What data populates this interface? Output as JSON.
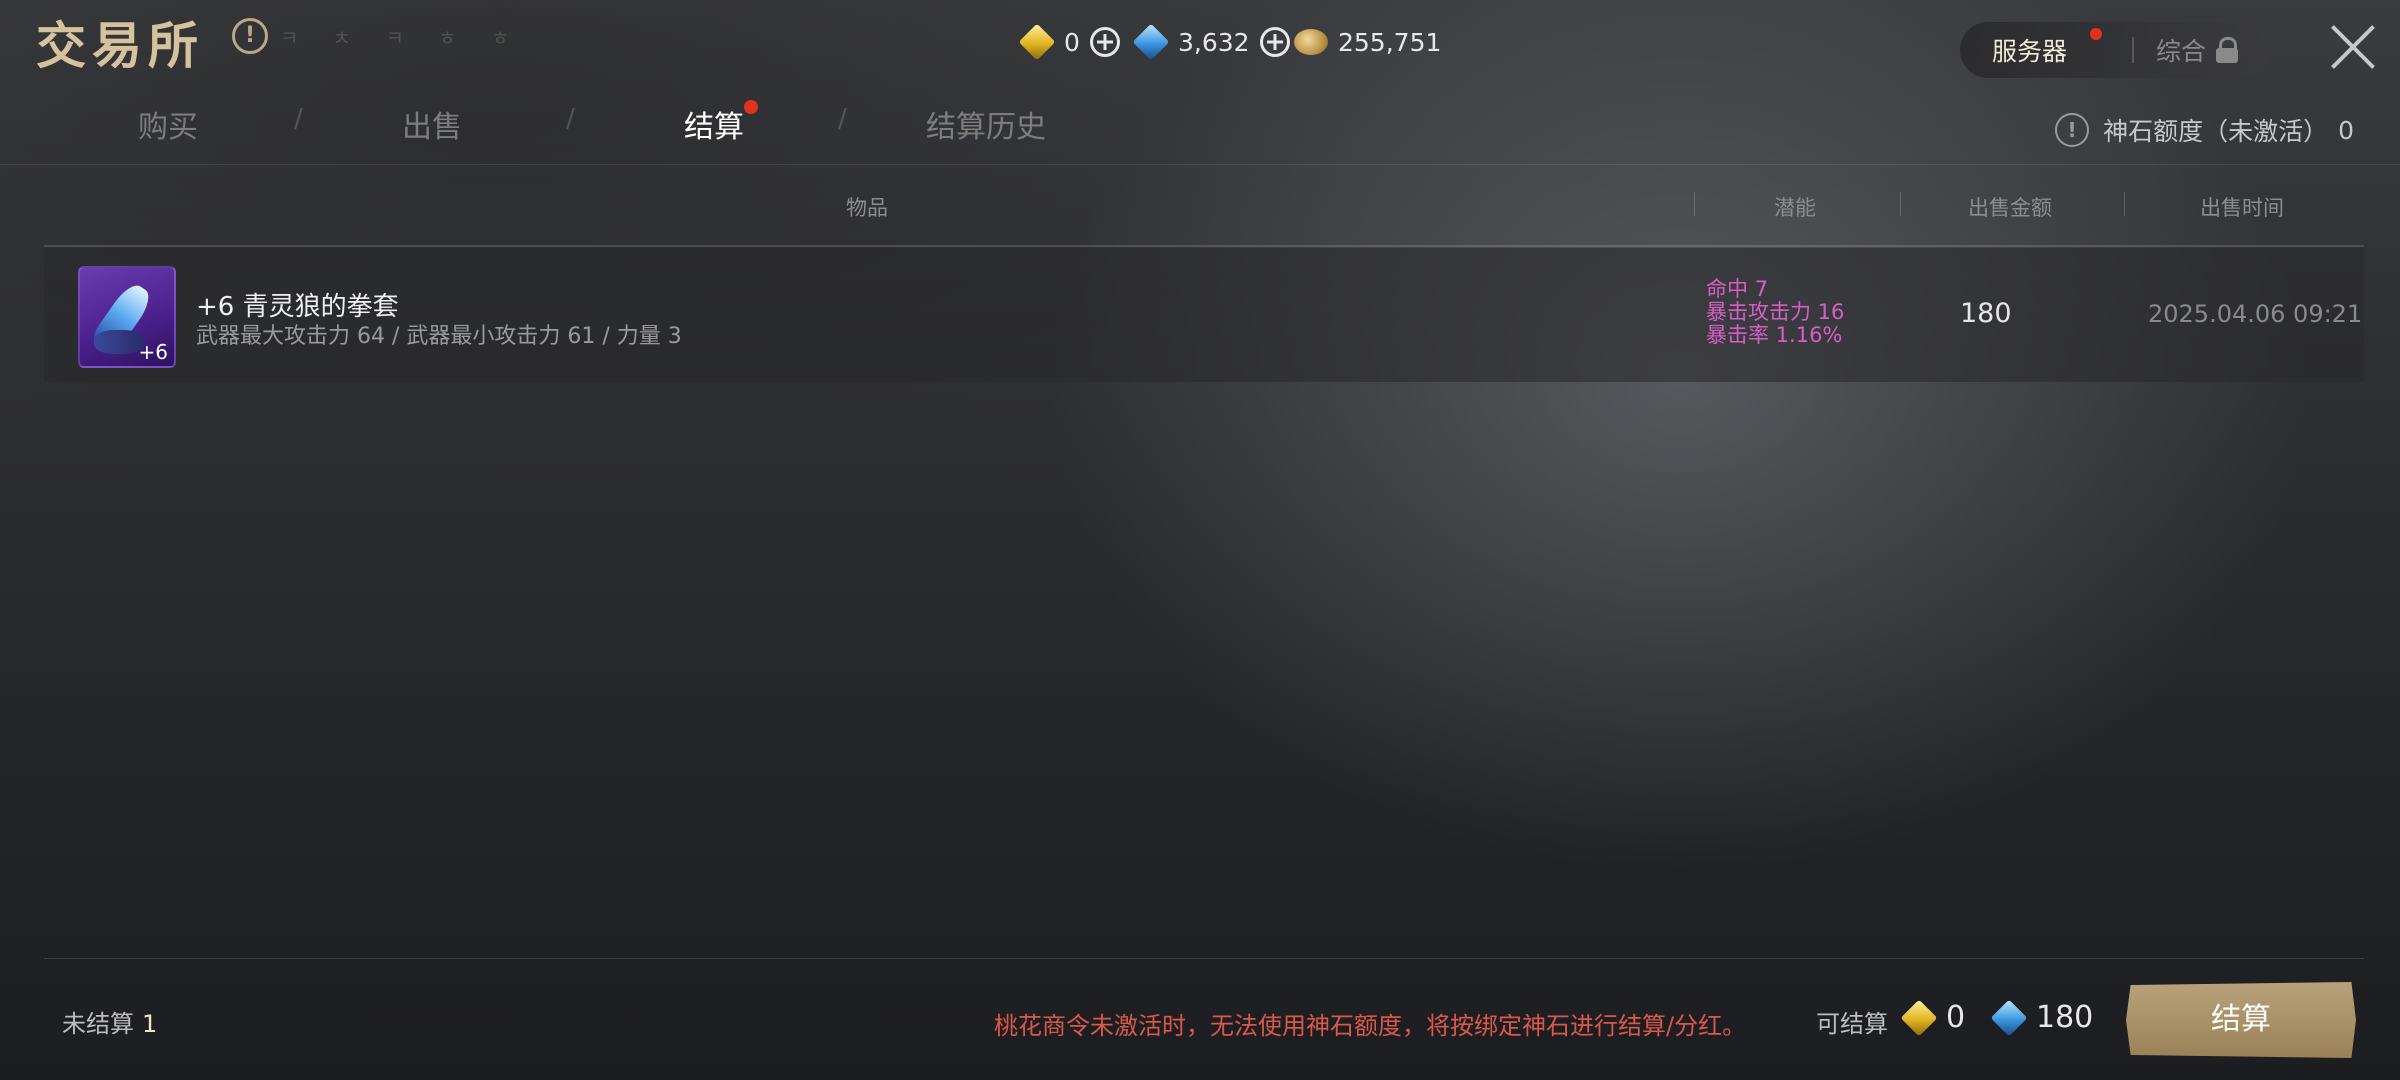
{
  "header": {
    "title": "交易所",
    "title_faint": "ㅋ ㅊ ㅋ ㅎ ㅎ",
    "currencies": {
      "gold_gem": "0",
      "blue_gem": "3,632",
      "coins": "255,751"
    },
    "server_toggle": {
      "server": "服务器",
      "all": "综合"
    }
  },
  "tabs": [
    {
      "label": "购买"
    },
    {
      "label": "出售"
    },
    {
      "label": "结算"
    },
    {
      "label": "结算历史"
    }
  ],
  "quota": {
    "label": "神石额度（未激活）",
    "value": "0"
  },
  "table": {
    "headers": [
      "物品",
      "潜能",
      "出售金额",
      "出售时间"
    ],
    "rows": [
      {
        "level": "+6",
        "name": "+6 青灵狼的拳套",
        "stats": "武器最大攻击力 64  / 武器最小攻击力 61  / 力量 3",
        "potentials": [
          "命中 7",
          "暴击攻击力 16",
          "暴击率 1.16%"
        ],
        "amount": "180",
        "time": "2025.04.06 09:21"
      }
    ]
  },
  "footer": {
    "unsettled_label": "未结算",
    "unsettled_count": "1",
    "warning": "桃花商令未激活时，无法使用神石额度，将按绑定神石进行结算/分红。",
    "settle_label": "可结算",
    "settle_gold": "0",
    "settle_blue": "180",
    "settle_button": "结算"
  },
  "colors": {
    "accent_gold": "#d6c29c",
    "notification_dot": "#e0321c",
    "potential_text": "#d65fc7",
    "warning_text": "#d9584a",
    "settle_button": "#b9a27a"
  }
}
